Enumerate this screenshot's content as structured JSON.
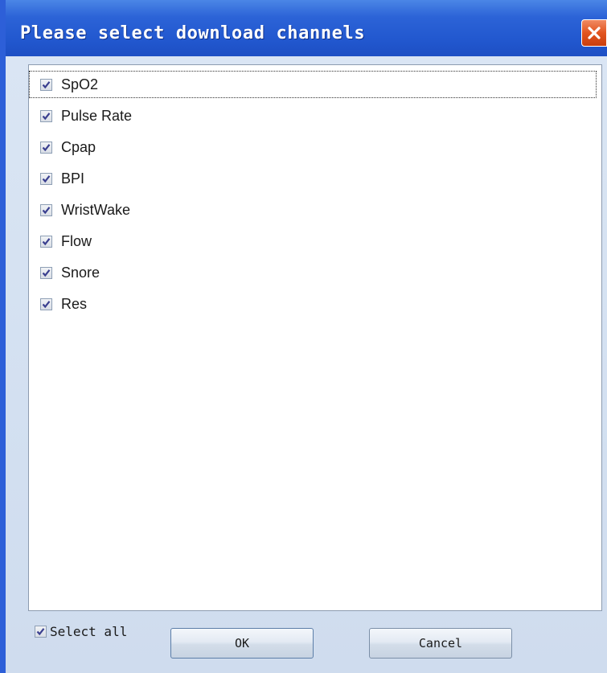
{
  "window": {
    "title": "Please select download channels",
    "close_icon": "close-icon"
  },
  "channels": [
    {
      "label": "SpO2",
      "checked": true
    },
    {
      "label": "Pulse Rate",
      "checked": true
    },
    {
      "label": "Cpap",
      "checked": true
    },
    {
      "label": "BPI",
      "checked": true
    },
    {
      "label": "WristWake",
      "checked": true
    },
    {
      "label": "Flow",
      "checked": true
    },
    {
      "label": "Snore",
      "checked": true
    },
    {
      "label": "Res",
      "checked": true
    }
  ],
  "footer": {
    "select_all_label": "Select all",
    "select_all_checked": true,
    "ok_label": "OK",
    "cancel_label": "Cancel"
  },
  "colors": {
    "titlebar": "#2258cf",
    "close_button": "#e2541f",
    "dialog_background": "#d3e0f1"
  }
}
